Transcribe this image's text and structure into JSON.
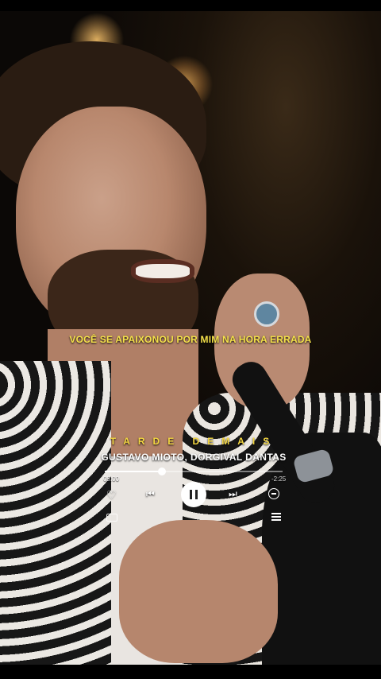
{
  "lyric": "VOCÊ SE APAIXONOU POR MIM NA HORA ERRADA",
  "player": {
    "title": "TARDE DEMAIS",
    "artist": "GUSTAVO MIOTO, DORGIVAL DANTAS",
    "current_time": "05:00",
    "remaining_time": "-2:25",
    "progress": 0.32,
    "icons": {
      "like": "heart-icon",
      "previous": "previous-icon",
      "play_pause": "pause-icon",
      "next": "next-icon",
      "remove": "minus-circle-icon",
      "lyrics": "lyrics-icon",
      "queue": "queue-icon"
    }
  },
  "colors": {
    "lyric": "#f5e14a",
    "title": "#f3d640"
  }
}
